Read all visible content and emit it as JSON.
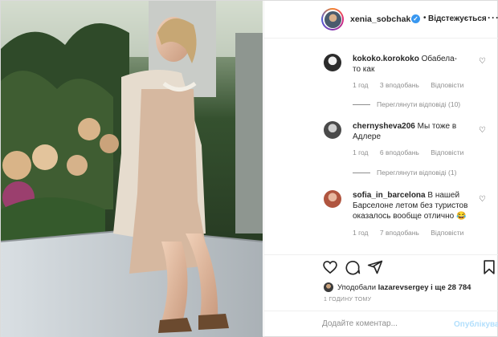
{
  "post": {
    "author": {
      "username": "xenia_sobchak",
      "verified": true,
      "follow_status": "Відстежується"
    },
    "comments": [
      {
        "username": "kokoko.korokoko",
        "text": "Обабела-то как",
        "time": "1 год",
        "likes": "3 вподобань",
        "reply": "Відповісти",
        "view_replies": "Переглянути відповіді (10)"
      },
      {
        "username": "chernysheva206",
        "text": "Мы тоже в Адлере",
        "time": "1 год",
        "likes": "6 вподобань",
        "reply": "Відповісти",
        "view_replies": "Переглянути відповіді (1)"
      },
      {
        "username": "sofia_in_barcelona",
        "text": "В нашей Барселоне летом без туристов оказалось вообще отлично 😂",
        "time": "1 год",
        "likes": "7 вподобань",
        "reply": "Відповісти"
      }
    ],
    "likes_summary": {
      "prefix": "Уподобали",
      "user": "lazarevsergey",
      "suffix": "і ще 28 784"
    },
    "timestamp": "1 ГОДИНУ ТОМУ",
    "add_comment": {
      "placeholder": "Додайте коментар...",
      "publish_label": "Опублікувати"
    },
    "icons": [
      "heart-icon",
      "comment-icon",
      "share-icon",
      "bookmark-icon",
      "more-icon",
      "verified-badge-icon"
    ],
    "colors": {
      "accent": "#3897f0",
      "muted": "#8e8e8e",
      "publish_disabled": "#b2dffc"
    }
  }
}
